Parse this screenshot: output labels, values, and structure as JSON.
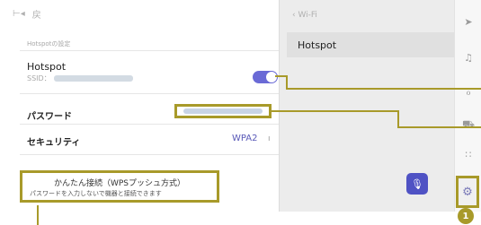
{
  "left": {
    "topbar_icon": "lock-icon",
    "back_label": "戻",
    "section_title": "Hotspotの設定",
    "hotspot_label": "Hotspot",
    "ssid_label": "SSID：",
    "password_label": "パスワード",
    "security_label": "セキュリティ",
    "security_value": "WPA2",
    "wps_title": "かんたん接続（WPSプッシュ方式）",
    "wps_sub": "パスワードを入力しないで機器と接続できます"
  },
  "right": {
    "breadcrumb": "‹  Wi-Fi",
    "active_item": "Hotspot"
  },
  "callout": {
    "badge": "1",
    "accent": "#a89a2a"
  },
  "colors": {
    "toggle_on": "#6a6ad6",
    "mic_button": "#4f52c4"
  }
}
